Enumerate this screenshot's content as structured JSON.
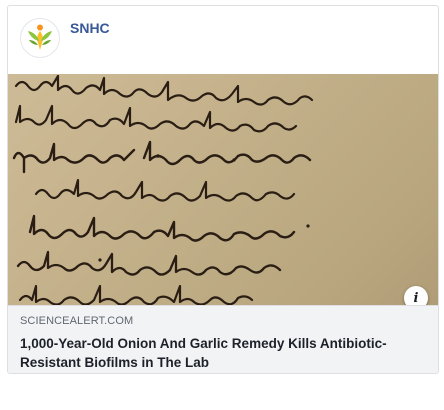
{
  "post": {
    "page_name": "SNHC",
    "avatar_icon": "snhc-logo-icon",
    "link": {
      "domain": "SCIENCEALERT.COM",
      "title": "1,000-Year-Old Onion And Garlic Remedy Kills Antibiotic-Resistant Biofilms in The Lab",
      "image_icon": "manuscript-image",
      "info_icon": "info-icon"
    }
  },
  "colors": {
    "page_name": "#385898",
    "logo_green": "#8cc63f",
    "logo_orange": "#f7941d",
    "logo_yellow": "#fbc02d",
    "parchment": "#c7b48e",
    "ink": "#2a1e14",
    "meta_background": "#f2f3f5"
  }
}
